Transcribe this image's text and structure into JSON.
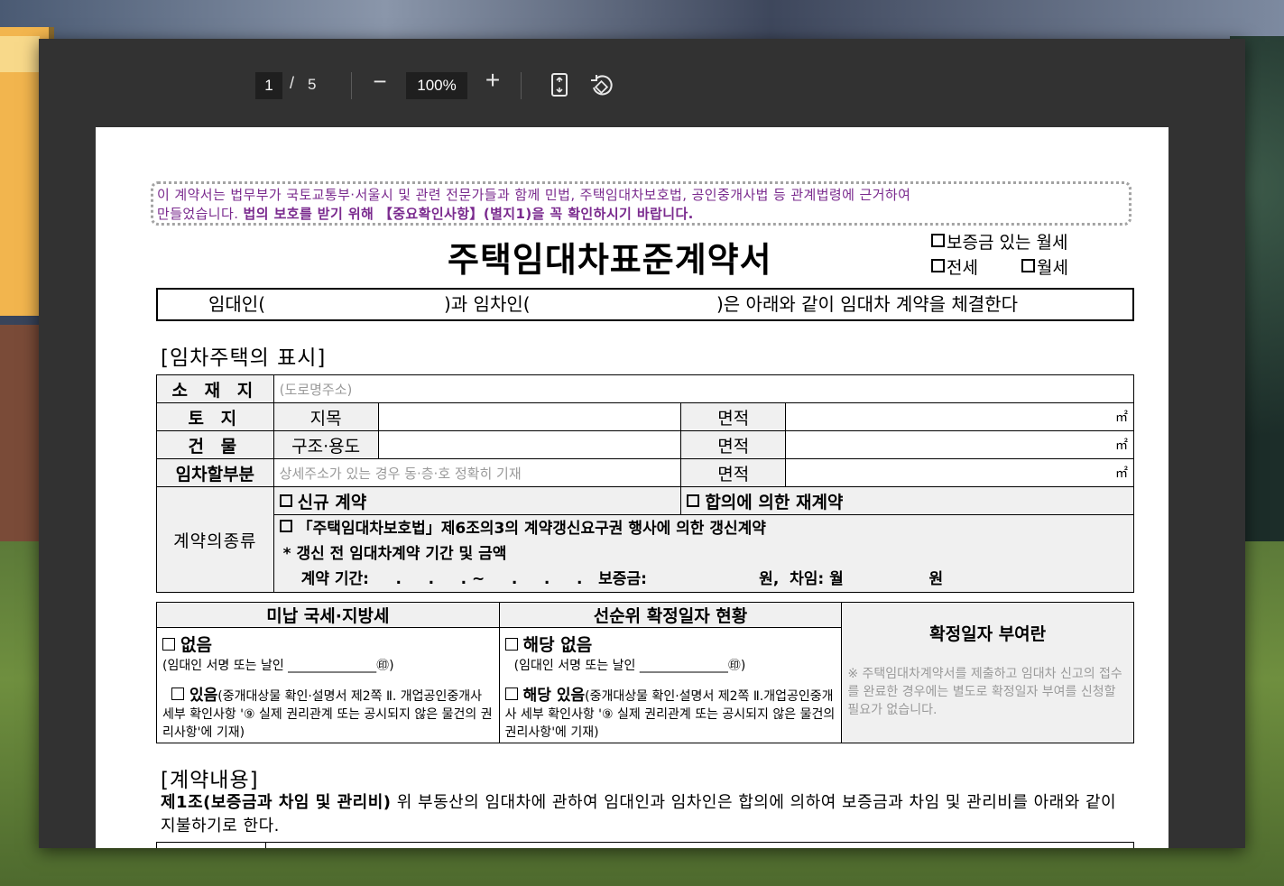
{
  "viewer": {
    "page_current": "1",
    "page_separator": "/",
    "page_total": "5",
    "zoom_minus": "−",
    "zoom_value": "100%",
    "zoom_plus": "+"
  },
  "doc": {
    "notice_line1": "이 계약서는 법무부가 국토교통부·서울시 및 관련 전문가들과 함께 민법, 주택임대차보호법, 공인중개사법 등 관계법령에 근거하여",
    "notice_line2_plain": "만들었습니다. ",
    "notice_line2_bold": "법의 보호를 받기 위해 【중요확인사항】(별지1)을 꼭 확인하시기 바랍니다.",
    "title": "주택임대차표준계약서",
    "type_1": "보증금 있는 월세",
    "type_2": "전세",
    "type_3": "월세",
    "party_lessor": "임대인(",
    "party_mid": ")과 임차인(",
    "party_tail": ")은 아래와 같이 임대차 계약을 체결한다",
    "section_property": "[임차주택의 표시]",
    "row_location_label": "소 재 지",
    "row_location_placeholder": "(도로명주소)",
    "row_land_label": "토  지",
    "row_land_sub": "지목",
    "row_building_label": "건  물",
    "row_building_sub": "구조·용도",
    "row_part_label": "임차할부분",
    "row_part_placeholder": "상세주소가 있는 경우 동·층·호 정확히 기재",
    "area_label": "면적",
    "area_unit": "㎡",
    "contract_type_label": "계약의종류",
    "ct_new": "신규 계약",
    "ct_renew_agree": "합의에 의한 재계약",
    "ct_renew_right": "「주택임대차보호법」제6조의3의 계약갱신요구권 행사에 의한 갱신계약",
    "ct_note": "* 갱신 전 임대차계약 기간 및 금액",
    "ct_period": "계약 기간:     .     .     . ~     .     .     .   보증금:                     원,  차임: 월                원",
    "tax_header": "미납 국세·지방세",
    "priority_header": "선순위 확정일자 현황",
    "tax_none": "없음",
    "tax_none_sign": "(임대인 서명 또는 날인 ______________㊞)",
    "tax_exist": "있음",
    "tax_exist_note": "(중개대상물 확인·설명서 제2쪽 Ⅱ. 개업공인중개사 세부 확인사항 '⑨ 실제 권리관계 또는 공시되지 않은 물건의 권리사항'에 기재)",
    "pri_none": "해당 없음",
    "pri_none_sign": "(임대인 서명 또는 날인 ______________㊞)",
    "pri_exist": "해당 있음",
    "pri_exist_note": "(중개대상물 확인·설명서 제2쪽 Ⅱ.개업공인중개사 세부 확인사항 '⑨ 실제 권리관계 또는 공시되지 않은 물건의 권리사항'에 기재)",
    "fixdate_title": "확정일자 부여란",
    "fixdate_note": "※ 주택임대차계약서를 제출하고 임대차 신고의 접수를 완료한 경우에는 별도로 확정일자 부여를 신청할 필요가 없습니다.",
    "section_contract": "[계약내용]",
    "article1_title": "제1조(보증금과 차임 및 관리비)",
    "article1_text": " 위 부동산의 임대차에 관하여 임대인과 임차인은 합의에 의하여 보증금과 차임 및 관리비를 아래와 같이 지불하기로 한다."
  }
}
